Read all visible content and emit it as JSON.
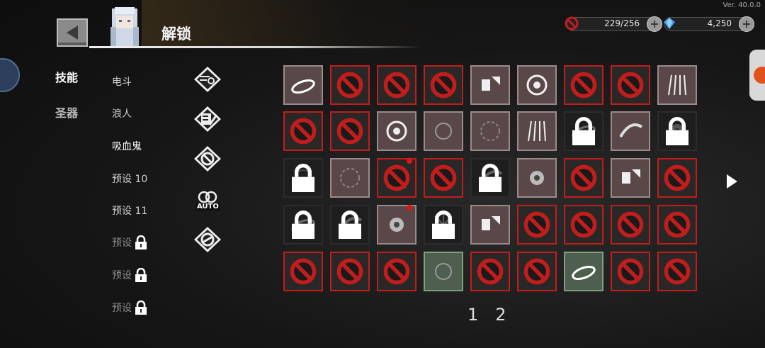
{
  "version": "Ver. 40.0.0",
  "header": {
    "title": "解锁",
    "back_icon": "back-arrow-icon"
  },
  "currency": {
    "gold": {
      "value": "229/256",
      "icon": "no-entry-icon"
    },
    "gems": {
      "value": "4,250",
      "icon": "diamond-icon"
    }
  },
  "tabs": [
    {
      "label": "技能",
      "active": true
    },
    {
      "label": "圣器",
      "active": false
    }
  ],
  "presets": [
    {
      "label": "电斗",
      "locked": false,
      "active": false
    },
    {
      "label": "浪人",
      "locked": false,
      "active": false
    },
    {
      "label": "吸血鬼",
      "locked": false,
      "active": true
    },
    {
      "label": "预设 10",
      "locked": false,
      "active": false
    },
    {
      "label": "预设 11",
      "locked": false,
      "active": false
    },
    {
      "label": "预设",
      "locked": true,
      "active": false
    },
    {
      "label": "预设",
      "locked": true,
      "active": false
    },
    {
      "label": "预设",
      "locked": true,
      "active": false
    }
  ],
  "tools": [
    {
      "name": "search-filter-icon"
    },
    {
      "name": "checklist-edit-icon"
    },
    {
      "name": "cancel-ring-icon"
    },
    {
      "name": "auto-ring-icon",
      "label": "AUTO"
    },
    {
      "name": "cancel-double-ring-icon"
    }
  ],
  "grid": {
    "rows": [
      [
        "own",
        "unlockable",
        "unlockable",
        "unlockable",
        "own",
        "own",
        "unlockable",
        "unlockable",
        "own"
      ],
      [
        "unlockable",
        "unlockable",
        "own",
        "own",
        "own",
        "own",
        "locked",
        "own",
        "locked"
      ],
      [
        "locked",
        "own",
        "unlockable",
        "unlockable",
        "locked",
        "own",
        "unlockable",
        "own",
        "unlockable"
      ],
      [
        "locked",
        "locked",
        "own",
        "locked",
        "own",
        "unlockable",
        "unlockable",
        "unlockable",
        "unlockable"
      ],
      [
        "unlockable",
        "unlockable",
        "unlockable",
        "equip",
        "unlockable",
        "unlockable",
        "equip",
        "unlockable",
        "unlockable"
      ]
    ],
    "new_badges": [
      [
        2,
        2
      ],
      [
        3,
        2
      ]
    ],
    "colors": {
      "ban": "#c21d1d",
      "badge": "#e01616"
    }
  },
  "pagination": {
    "pages": [
      "1",
      "2"
    ],
    "next_icon": "next-arrow-icon"
  }
}
